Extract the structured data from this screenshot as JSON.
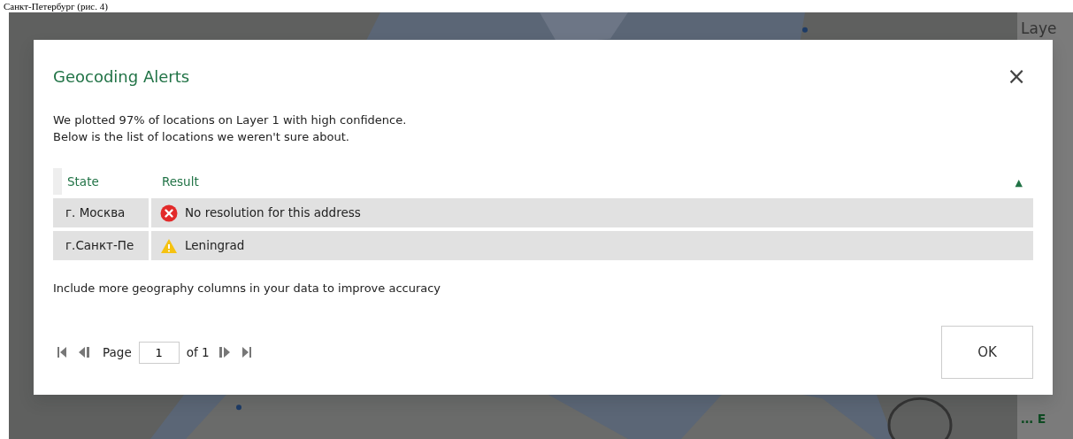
{
  "caption": "Санкт-Петербург (рис. 4)",
  "side_panel": {
    "heading": "Laye",
    "footer": "… E"
  },
  "dialog": {
    "title": "Geocoding Alerts",
    "close": "×",
    "message": [
      "We plotted 97% of locations on Layer 1 with high confidence.",
      "Below is the list of locations we weren't sure about."
    ],
    "table": {
      "columns": [
        "State",
        "Result"
      ],
      "sort_indicator": "▲",
      "rows": [
        {
          "state": "г. Москва",
          "kind": "error",
          "result": "No resolution for this address"
        },
        {
          "state": "г.Санкт-Пе",
          "kind": "warning",
          "result": "Leningrad"
        }
      ]
    },
    "hint": "Include more geography columns in your data to improve accuracy",
    "pager": {
      "label": "Page",
      "page": "1",
      "of": "of 1"
    },
    "ok": "OK"
  }
}
